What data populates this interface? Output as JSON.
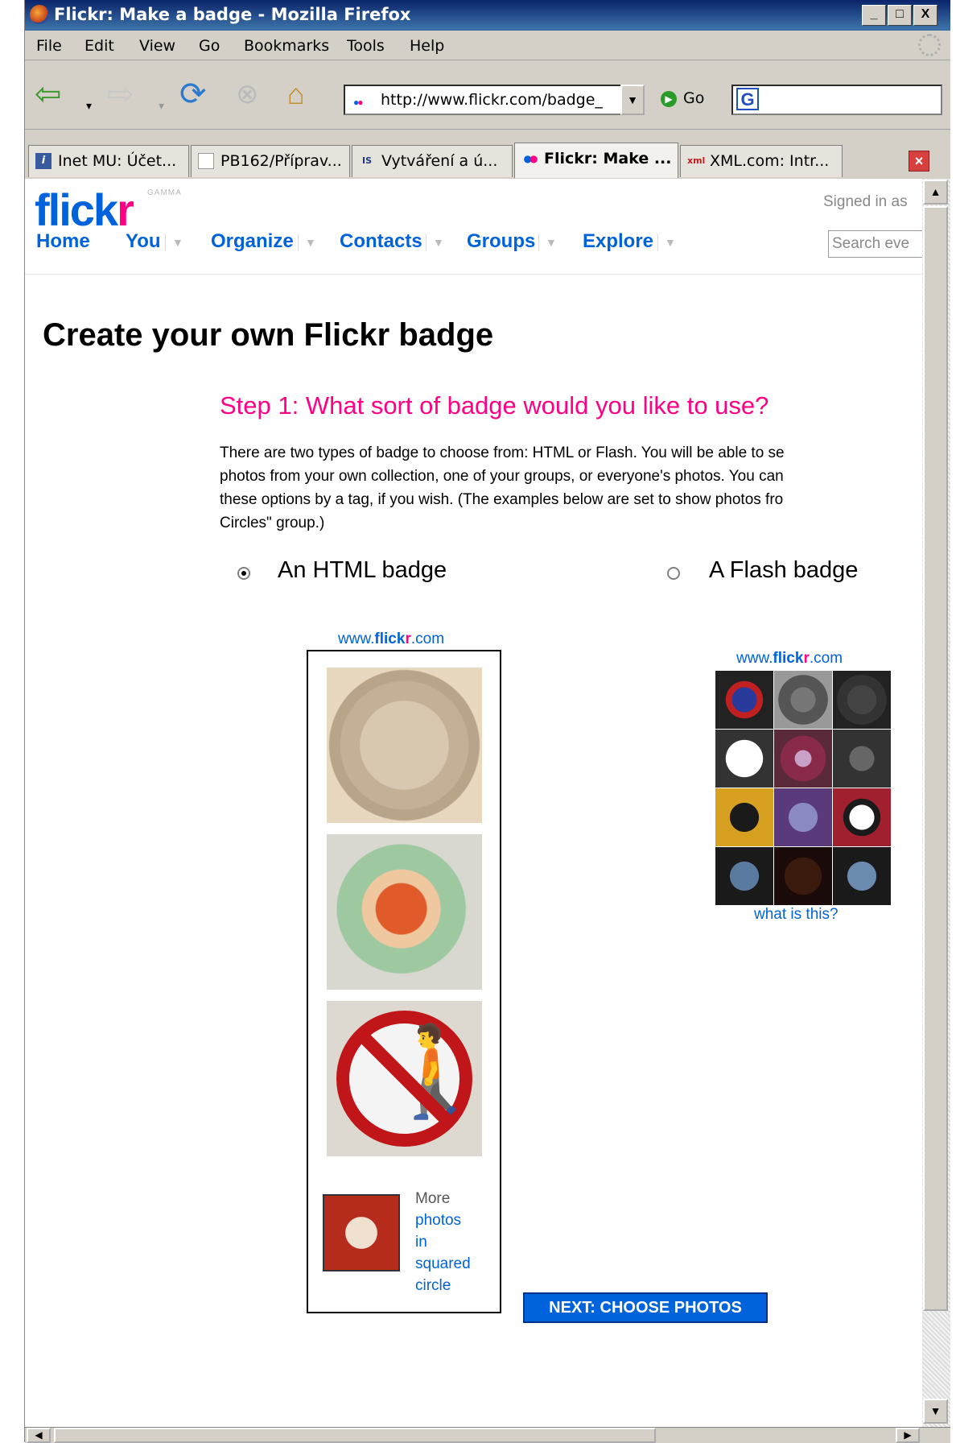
{
  "window": {
    "title": "Flickr: Make a badge - Mozilla Firefox",
    "controls": [
      "_",
      "□",
      "X"
    ]
  },
  "menu": [
    "File",
    "Edit",
    "View",
    "Go",
    "Bookmarks",
    "Tools",
    "Help"
  ],
  "toolbar": {
    "url": "http://www.flickr.com/badge_",
    "go_label": "Go",
    "search_logo": "G"
  },
  "tabs": [
    {
      "label": "Inet MU: Účet...",
      "icon": "info-icon"
    },
    {
      "label": "PB162/Příprav...",
      "icon": "document-icon"
    },
    {
      "label": "Vytváření a ú...",
      "icon": "is-icon"
    },
    {
      "label": "Flickr: Make ...",
      "icon": "flickr-icon",
      "active": true
    },
    {
      "label": "XML.com: Intr...",
      "icon": "xml-icon"
    }
  ],
  "page": {
    "logo": {
      "blue": "flick",
      "pink": "r",
      "tag": "GAMMA"
    },
    "signed_in": "Signed in as",
    "nav": [
      "Home",
      "You",
      "Organize",
      "Contacts",
      "Groups",
      "Explore"
    ],
    "search_placeholder": "Search eve",
    "heading": "Create your own Flickr badge",
    "step_heading": "Step 1: What sort of badge would you like to use?",
    "description_lines": [
      "There are two types of badge to choose from: HTML or Flash. You will be able to se",
      "photos from your own collection, one of your groups, or everyone's photos. You can",
      "these options by a tag, if you wish. (The examples below are set to show photos fro",
      "Circles\" group.)"
    ],
    "options": {
      "html_label": "An HTML badge",
      "flash_label": "A Flash badge",
      "selected": "html"
    },
    "badge_header": {
      "prefix": "www.",
      "blue": "flick",
      "pink": "r",
      "suffix": ".com"
    },
    "more": {
      "static": "More",
      "link_lines": [
        "photos",
        "in",
        "squared",
        "circle"
      ]
    },
    "what_is_this": "what is this?",
    "next_button": "NEXT: CHOOSE PHOTOS"
  },
  "colors": {
    "flickr_blue": "#0063dc",
    "flickr_pink": "#ff0084",
    "titlebar": "#0a246a"
  }
}
